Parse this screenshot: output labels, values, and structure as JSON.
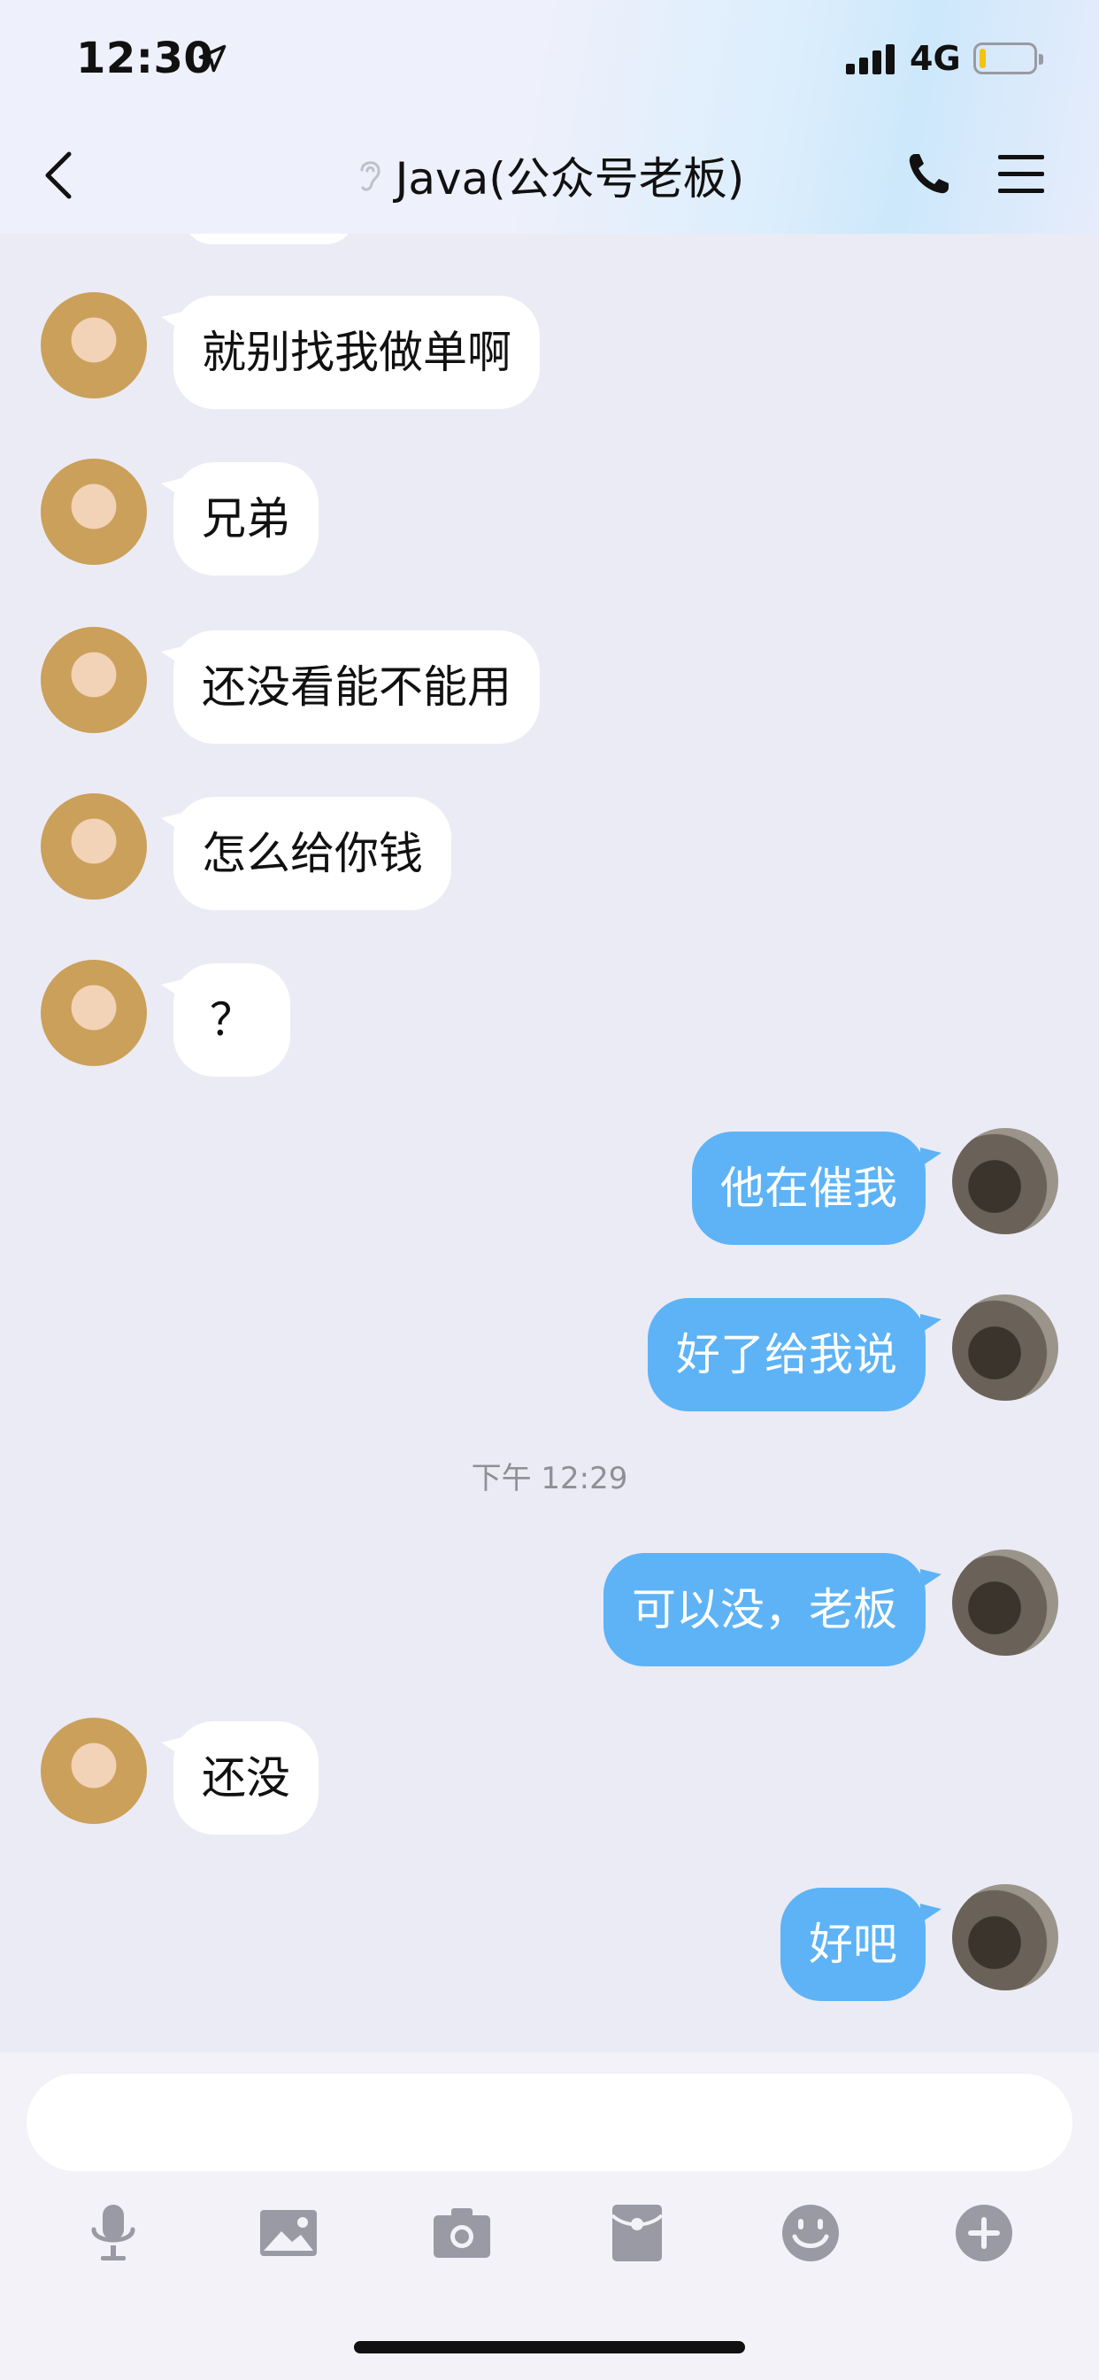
{
  "status_bar": {
    "time": "12:30",
    "network": "4G"
  },
  "header": {
    "title": "Java(公众号老板)"
  },
  "messages": [
    {
      "side": "in",
      "text": "就别找我做单啊"
    },
    {
      "side": "in",
      "text": "兄弟"
    },
    {
      "side": "in",
      "text": "还没看能不能用"
    },
    {
      "side": "in",
      "text": "怎么给你钱"
    },
    {
      "side": "in",
      "text": "？"
    },
    {
      "side": "out",
      "text": "他在催我"
    },
    {
      "side": "out",
      "text": "好了给我说"
    },
    {
      "side": "out",
      "text": "可以没，老板"
    },
    {
      "side": "in",
      "text": "还没"
    },
    {
      "side": "out",
      "text": "好吧"
    }
  ],
  "timestamp": "下午 12:29",
  "input": {
    "placeholder": ""
  },
  "toolbar": {
    "icons": [
      "microphone-icon",
      "image-icon",
      "camera-icon",
      "red-packet-icon",
      "emoji-icon",
      "plus-icon"
    ]
  },
  "colors": {
    "outgoing_bubble": "#5db3f6",
    "incoming_bubble": "#ffffff",
    "background": "#ebebf5"
  }
}
